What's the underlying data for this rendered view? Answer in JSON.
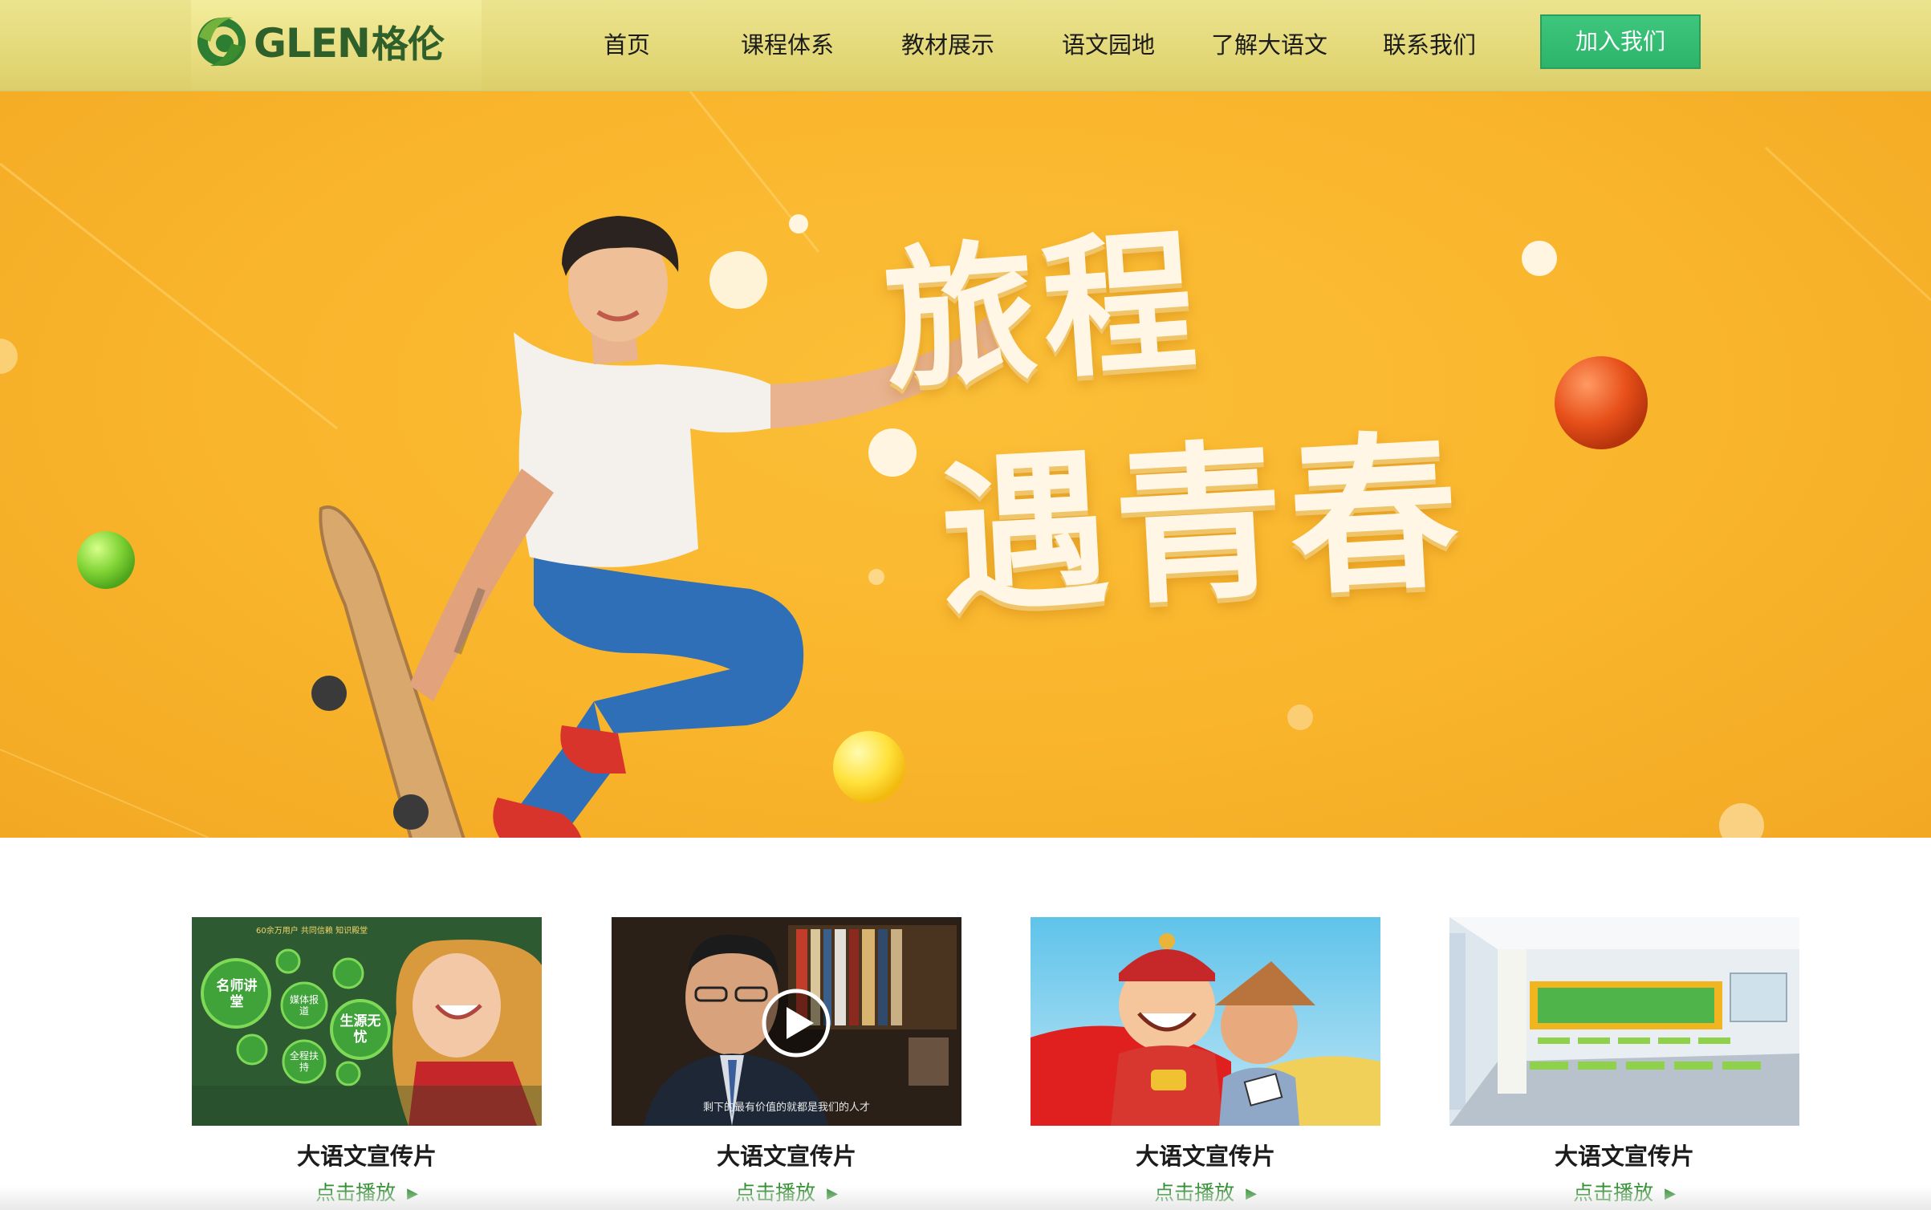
{
  "header": {
    "logo_text": "GLEN",
    "logo_cn": "格伦",
    "nav": [
      {
        "label": "首页"
      },
      {
        "label": "课程体系"
      },
      {
        "label": "教材展示"
      },
      {
        "label": "语文园地"
      },
      {
        "label": "了解大语文"
      },
      {
        "label": "联系我们"
      }
    ],
    "join_label": "加入我们"
  },
  "banner": {
    "line1": "旅程",
    "line2": "遇青春"
  },
  "cards": [
    {
      "title": "大语文宣传片",
      "play_label": "点击播放",
      "thumb": {
        "banner_text": "60余万用户 共同信赖 知识殿堂",
        "bubbles": [
          "名师讲堂",
          "媒体报道",
          "生源无忧",
          "全程扶持"
        ]
      }
    },
    {
      "title": "大语文宣传片",
      "play_label": "点击播放",
      "thumb": {
        "caption": "剩下的最有价值的就都是我们的人才"
      }
    },
    {
      "title": "大语文宣传片",
      "play_label": "点击播放"
    },
    {
      "title": "大语文宣传片",
      "play_label": "点击播放"
    }
  ],
  "colors": {
    "header_bg": "#e4d97a",
    "banner_bg": "#f9b52c",
    "accent_green": "#2bb46a",
    "link_green": "#2f8f2f"
  }
}
